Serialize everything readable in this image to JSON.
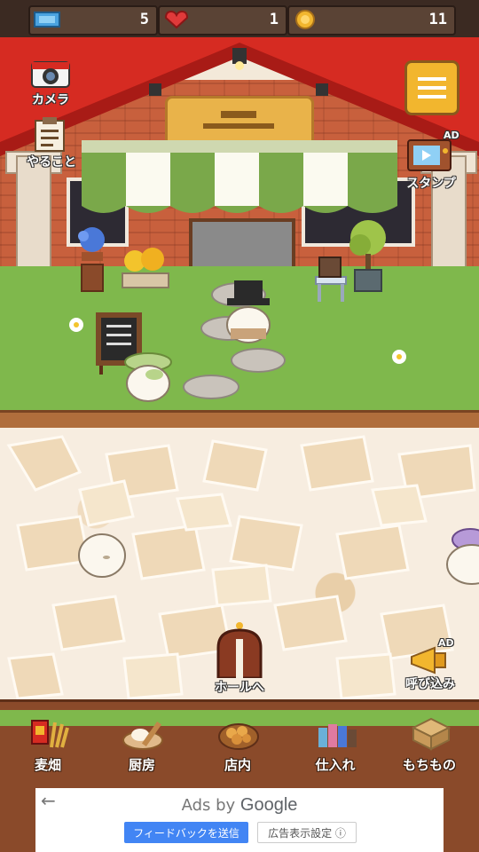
{
  "resources": {
    "tickets": "5",
    "hearts": "1",
    "coins": "11"
  },
  "buttons": {
    "camera": "カメラ",
    "todo": "やること",
    "stamp": "スタンプ",
    "stamp_ad": "AD",
    "to_hall": "ホールへ",
    "invite": "呼び込み",
    "invite_ad": "AD"
  },
  "nav": [
    {
      "label": "麦畑",
      "icon": "wheat-field-icon"
    },
    {
      "label": "厨房",
      "icon": "kitchen-icon"
    },
    {
      "label": "店内",
      "icon": "bread-tray-icon"
    },
    {
      "label": "仕入れ",
      "icon": "supplies-icon"
    },
    {
      "label": "もちもの",
      "icon": "box-icon"
    }
  ],
  "ad": {
    "ads_by": "Ads by",
    "brand": "Google",
    "feedback": "フィードバックを送信",
    "why": "広告表示設定 ⓘ"
  },
  "colors": {
    "roof": "#d62b22",
    "wall": "#c8603d",
    "lawn": "#7fb84c",
    "awning_green": "#7aa84a",
    "menu_button": "#f2b62e"
  }
}
